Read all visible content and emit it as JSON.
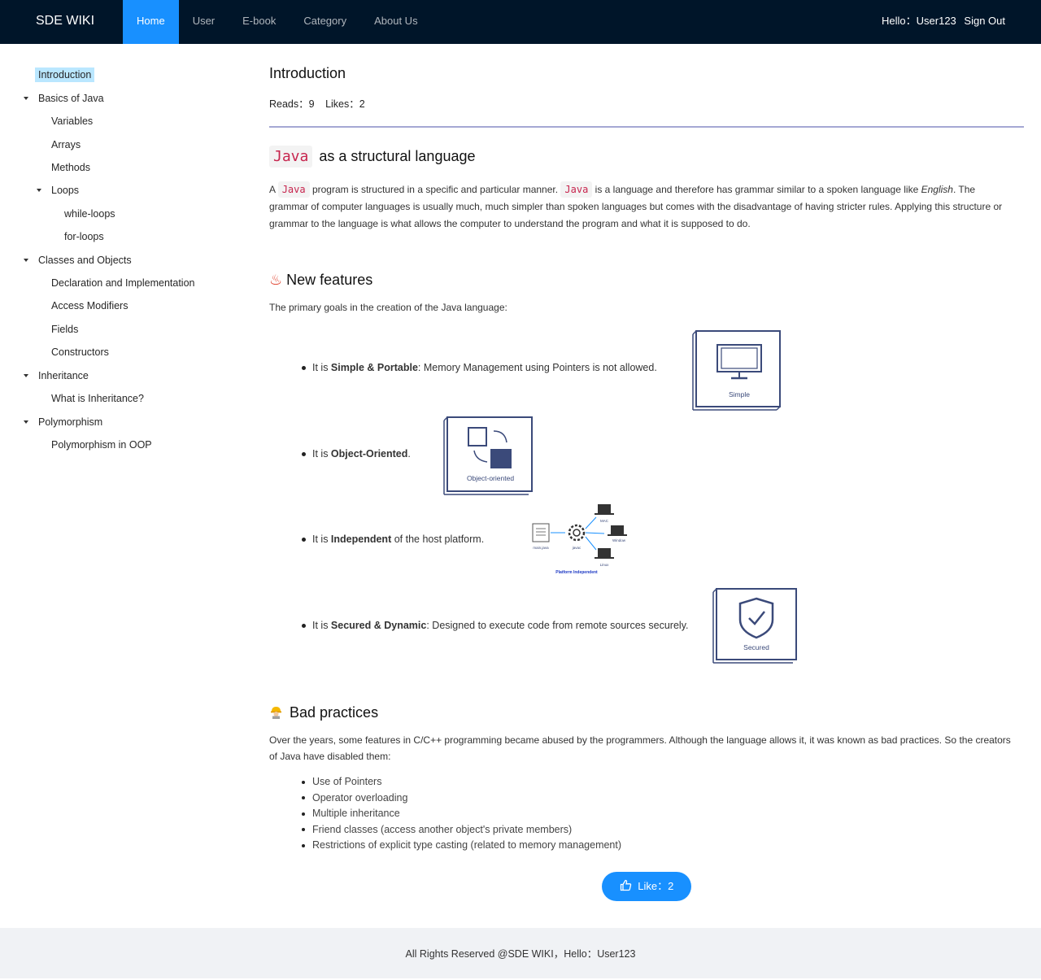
{
  "header": {
    "logo": "SDE WIKI",
    "nav": [
      "Home",
      "User",
      "E-book",
      "Category",
      "About Us"
    ],
    "active_nav": "Home",
    "greeting": "Hello：User123",
    "sign_out": "Sign Out"
  },
  "sidebar": {
    "items": [
      {
        "label": "Introduction",
        "selected": true
      },
      {
        "label": "Basics of Java",
        "expanded": true
      },
      {
        "label": "Variables"
      },
      {
        "label": "Arrays"
      },
      {
        "label": "Methods"
      },
      {
        "label": "Loops",
        "expanded": true
      },
      {
        "label": "while-loops"
      },
      {
        "label": "for-loops"
      },
      {
        "label": "Classes and Objects",
        "expanded": true
      },
      {
        "label": "Declaration and Implementation"
      },
      {
        "label": "Access Modifiers"
      },
      {
        "label": "Fields"
      },
      {
        "label": "Constructors"
      },
      {
        "label": "Inheritance",
        "expanded": true
      },
      {
        "label": "What is Inheritance?"
      },
      {
        "label": "Polymorphism",
        "expanded": true
      },
      {
        "label": "Polymorphism in OOP"
      }
    ]
  },
  "doc": {
    "title": "Introduction",
    "reads": "Reads：9",
    "likes": "Likes：2",
    "section1": {
      "code": "Java",
      "heading_rest": "as a structural language",
      "p_a": "A",
      "p_code1": "Java",
      "p_mid": "program is structured in a specific and particular manner.",
      "p_code2": "Java",
      "p_rest": "is a language and therefore has grammar similar to a spoken language like",
      "p_em": "English",
      "p_end": ". The grammar of computer languages is usually much, much simpler than spoken languages but comes with the disadvantage of having stricter rules. Applying this structure or grammar to the language is what allows the computer to understand the program and what it is supposed to do."
    },
    "section2": {
      "icon": "♨",
      "heading": "New features",
      "intro": "The primary goals in the creation of the Java language:",
      "features": [
        {
          "pre": "It is ",
          "bold": "Simple & Portable",
          "post": ": Memory Management using Pointers is not allowed.",
          "image_caption": "Simple"
        },
        {
          "pre": "It is ",
          "bold": "Object-Oriented",
          "post": ".",
          "image_caption": "Object-oriented"
        },
        {
          "pre": "It is ",
          "bold": "Independent",
          "post": " of the host platform.",
          "image_caption": "Platform Independent",
          "diagram_labels": [
            "main.java",
            "javac",
            "MAC",
            "Window",
            "Linux"
          ]
        },
        {
          "pre": "It is ",
          "bold": "Secured & Dynamic",
          "post": ": Designed to execute code from remote sources securely.",
          "image_caption": "Secured"
        }
      ]
    },
    "section3": {
      "heading": "Bad practices",
      "intro": "Over the years, some features in C/C++ programming became abused by the programmers. Although the language allows it, it was known as bad practices. So the creators of Java have disabled them:",
      "items": [
        "Use of Pointers",
        "Operator overloading",
        "Multiple inheritance",
        "Friend classes (access another object's private members)",
        "Restrictions of explicit type casting (related to memory management)"
      ]
    },
    "like_button": "Like：2"
  },
  "footer": {
    "text": "All Rights Reserved @SDE WIKI，Hello：User123"
  },
  "colors": {
    "header_bg": "#001529",
    "accent": "#1890ff",
    "selected_bg": "#bae7ff",
    "divider": "#a5a8d4",
    "code_text": "#c7254e",
    "illustration": "#3b4a7a"
  }
}
